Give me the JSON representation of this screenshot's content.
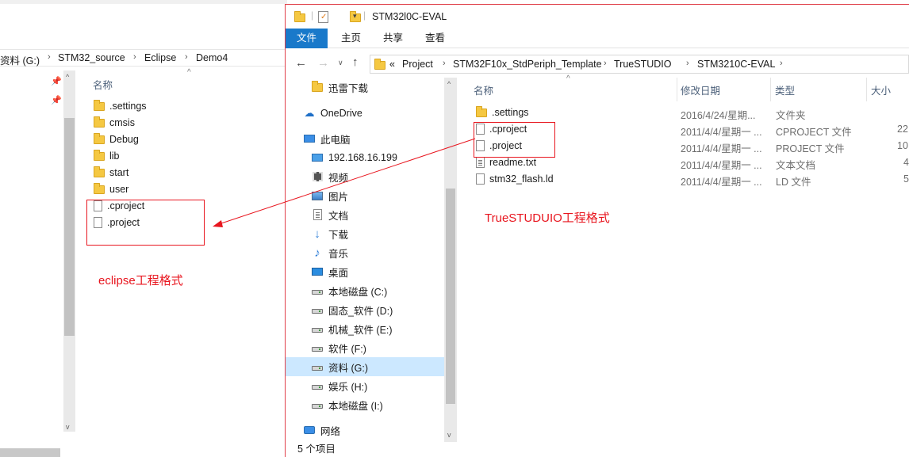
{
  "left_window": {
    "breadcrumb": [
      "资料 (G:)",
      "STM32_source",
      "Eclipse",
      "Demo4"
    ],
    "column_name": "名称",
    "items": [
      {
        "name": ".settings",
        "kind": "folder"
      },
      {
        "name": "cmsis",
        "kind": "folder"
      },
      {
        "name": "Debug",
        "kind": "folder"
      },
      {
        "name": "lib",
        "kind": "folder"
      },
      {
        "name": "start",
        "kind": "folder"
      },
      {
        "name": "user",
        "kind": "folder"
      },
      {
        "name": ".cproject",
        "kind": "file"
      },
      {
        "name": ".project",
        "kind": "file"
      }
    ]
  },
  "right_window": {
    "title": "STM32l0C-EVAL",
    "ribbon_tabs": [
      "文件",
      "主页",
      "共享",
      "查看"
    ],
    "breadcrumb_prefix": "«",
    "breadcrumb": [
      "Project",
      "STM32F10x_StdPeriph_Template",
      "TrueSTUDIO",
      "STM3210C-EVAL"
    ],
    "nav_items": [
      {
        "label": "迅雷下载",
        "icon": "folder-icon"
      },
      {
        "label": "OneDrive",
        "icon": "onedrive-icon"
      },
      {
        "label": "此电脑",
        "icon": "computer-icon"
      },
      {
        "label": "192.168.16.199",
        "icon": "network-drive-icon"
      },
      {
        "label": "视频",
        "icon": "video-icon"
      },
      {
        "label": "图片",
        "icon": "picture-icon"
      },
      {
        "label": "文档",
        "icon": "document-icon"
      },
      {
        "label": "下载",
        "icon": "download-icon"
      },
      {
        "label": "音乐",
        "icon": "music-icon"
      },
      {
        "label": "桌面",
        "icon": "desktop-icon"
      },
      {
        "label": "本地磁盘 (C:)",
        "icon": "drive-c-icon"
      },
      {
        "label": "固态_软件 (D:)",
        "icon": "drive-icon"
      },
      {
        "label": "机械_软件 (E:)",
        "icon": "drive-icon"
      },
      {
        "label": "软件 (F:)",
        "icon": "drive-icon"
      },
      {
        "label": "资料 (G:)",
        "icon": "drive-icon",
        "selected": true
      },
      {
        "label": "娱乐 (H:)",
        "icon": "drive-icon"
      },
      {
        "label": "本地磁盘 (I:)",
        "icon": "drive-icon"
      },
      {
        "label": "网络",
        "icon": "network-icon"
      }
    ],
    "columns": {
      "name": "名称",
      "date": "修改日期",
      "type": "类型",
      "size": "大小"
    },
    "files": [
      {
        "name": ".settings",
        "date": "2016/4/24/星期...",
        "type": "文件夹",
        "size": "",
        "kind": "folder"
      },
      {
        "name": ".cproject",
        "date": "2011/4/4/星期一 ...",
        "type": "CPROJECT 文件",
        "size": "22",
        "kind": "file"
      },
      {
        "name": ".project",
        "date": "2011/4/4/星期一 ...",
        "type": "PROJECT 文件",
        "size": "10",
        "kind": "file"
      },
      {
        "name": "readme.txt",
        "date": "2011/4/4/星期一 ...",
        "type": "文本文档",
        "size": "4",
        "kind": "text"
      },
      {
        "name": "stm32_flash.ld",
        "date": "2011/4/4/星期一 ...",
        "type": "LD 文件",
        "size": "5",
        "kind": "file"
      }
    ],
    "status": "5 个项目"
  },
  "annotations": {
    "eclipse_label": "eclipse工程格式",
    "truestudio_label": "TrueSTUDUIO工程格式",
    "color": "#e8161f"
  }
}
